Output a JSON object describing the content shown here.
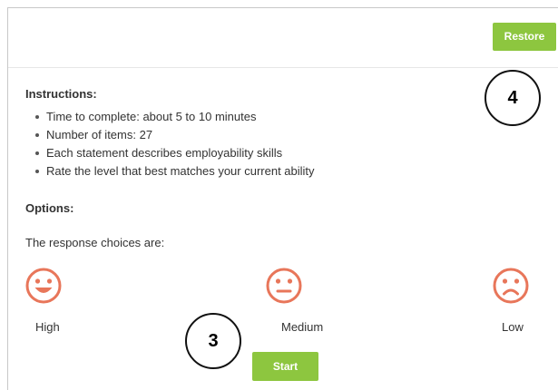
{
  "toolbar": {
    "restore_label": "Restore"
  },
  "instructions": {
    "heading": "Instructions:",
    "items": [
      "Time to complete: about 5 to 10 minutes",
      "Number of items: 27",
      "Each statement describes employability skills",
      "Rate the level that best matches your current ability"
    ]
  },
  "options": {
    "heading": "Options:",
    "response_text": "The response choices are:",
    "choices": [
      {
        "label": "High",
        "icon": "happy-face-icon"
      },
      {
        "label": "Medium",
        "icon": "neutral-face-icon"
      },
      {
        "label": "Low",
        "icon": "sad-face-icon"
      }
    ]
  },
  "actions": {
    "start_label": "Start"
  },
  "callouts": {
    "restore_marker": "4",
    "start_marker": "3"
  },
  "colors": {
    "button_green": "#8dc63f",
    "face_orange": "#e8765a"
  }
}
